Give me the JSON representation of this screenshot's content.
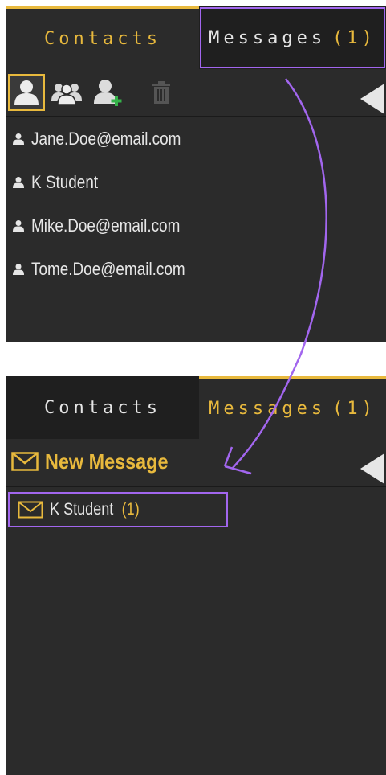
{
  "top_panel": {
    "tabs": {
      "contacts": "Contacts",
      "messages": "Messages",
      "messages_count": "(1)"
    },
    "toolbar": {
      "icons": [
        "single-contact-icon",
        "group-contacts-icon",
        "add-contact-icon",
        "trash-icon"
      ],
      "collapse_icon": "collapse-left-icon"
    },
    "contacts": [
      {
        "label": "Jane.Doe@email.com"
      },
      {
        "label": "K Student"
      },
      {
        "label": "Mike.Doe@email.com"
      },
      {
        "label": "Tome.Doe@email.com"
      }
    ]
  },
  "bottom_panel": {
    "tabs": {
      "contacts": "Contacts",
      "messages": "Messages",
      "messages_count": "(1)"
    },
    "new_message": "New Message",
    "messages": [
      {
        "sender": "K Student",
        "count": "(1)"
      }
    ]
  },
  "colors": {
    "accent": "#e8b93d",
    "panel": "#2b2b2b",
    "highlight": "#a266ee",
    "text": "#e6e6e6"
  }
}
